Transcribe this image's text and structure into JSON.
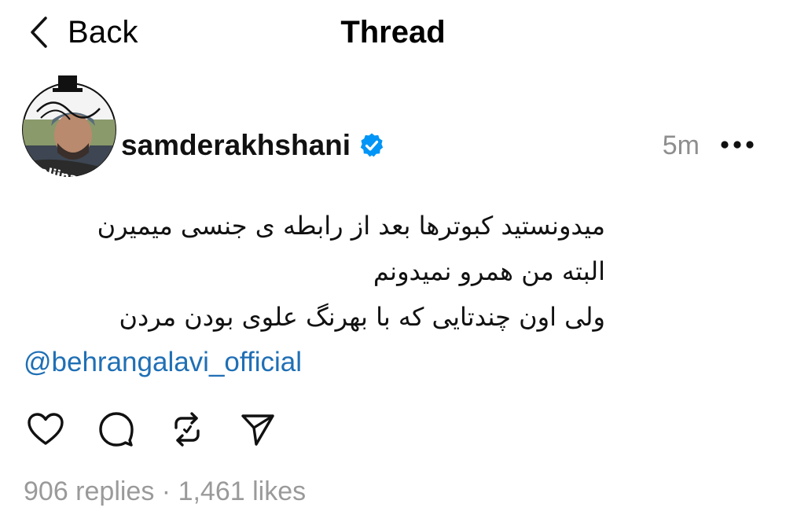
{
  "header": {
    "back_label": "Back",
    "title": "Thread"
  },
  "post": {
    "username": "samderakhshani",
    "verified": true,
    "timestamp": "5m",
    "lines": [
      "میدونستید کبوترها بعد از رابطه ی جنسی میمیرن",
      "البته من همرو نمیدونم",
      "ولی اون چندتایی که با بهرنگ علوی بودن مردن"
    ],
    "mention": "@behrangalavi_official",
    "avatar_text": "Aalijna"
  },
  "actions": {
    "like_icon": "heart-icon",
    "reply_icon": "comment-bubble-icon",
    "repost_icon": "repost-icon",
    "share_icon": "send-icon"
  },
  "stats": {
    "replies": "906 replies",
    "separator": " · ",
    "likes": "1,461 likes"
  },
  "colors": {
    "text": "#000000",
    "muted": "#8e8e8e",
    "link": "#1f6fb5",
    "verified": "#0095f6"
  }
}
